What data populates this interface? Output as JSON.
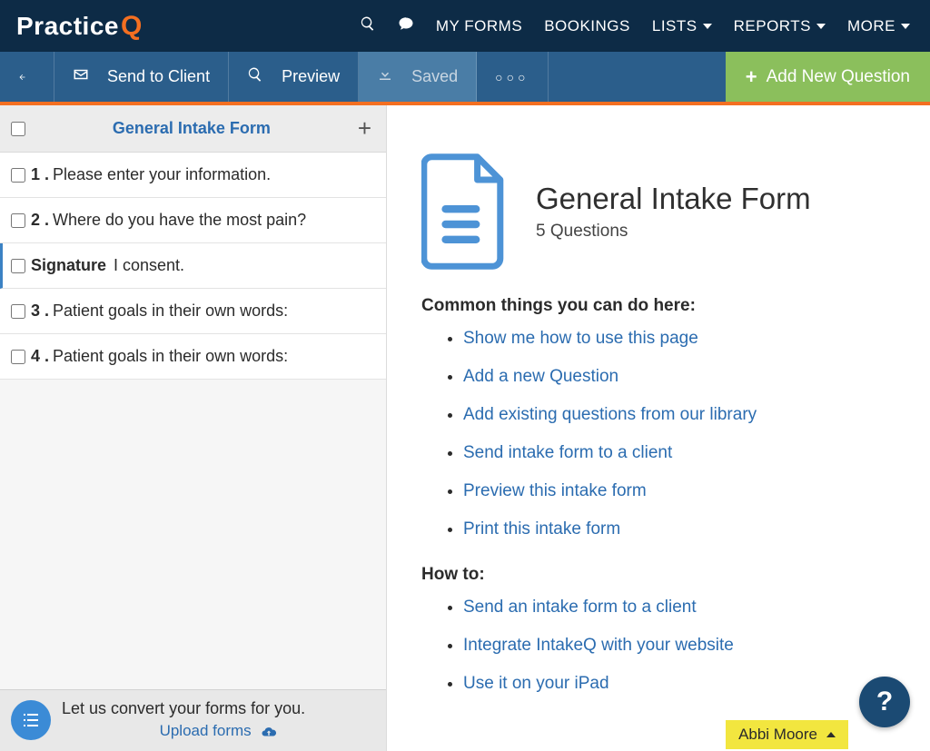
{
  "brand": {
    "name": "Practice",
    "accent_letter": "Q"
  },
  "topnav": {
    "items": [
      "MY FORMS",
      "BOOKINGS",
      "LISTS",
      "REPORTS",
      "MORE"
    ],
    "dropdown_flags": [
      false,
      false,
      true,
      true,
      true
    ]
  },
  "toolbar": {
    "send_label": "Send to Client",
    "preview_label": "Preview",
    "saved_label": "Saved",
    "add_new_label": "Add New Question"
  },
  "sidebar": {
    "form_title": "General Intake Form",
    "questions": [
      {
        "num": "1 .",
        "text": "Please enter your information."
      },
      {
        "num": "2 .",
        "text": "Where do you have the most pain?"
      },
      {
        "signature": true,
        "sig_label": "Signature",
        "text": "I consent."
      },
      {
        "num": "3 .",
        "text": "Patient goals in their own words:"
      },
      {
        "num": "4 .",
        "text": "Patient goals in their own words:"
      }
    ],
    "promo_line1": "Let us convert your forms for you.",
    "promo_cta": "Upload forms"
  },
  "main": {
    "title": "General Intake Form",
    "subtitle": "5 Questions",
    "common_heading": "Common things you can do here:",
    "common_links": [
      "Show me how to use this page",
      "Add a new Question",
      "Add existing questions from our library",
      "Send intake form to a client",
      "Preview this intake form",
      "Print this intake form"
    ],
    "howto_heading": "How to:",
    "howto_links": [
      "Send an intake form to a client",
      "Integrate IntakeQ with your website",
      "Use it on your iPad"
    ]
  },
  "user": {
    "name": "Abbi Moore"
  },
  "colors": {
    "brand_orange": "#f36f21",
    "nav_blue": "#0d2b46",
    "toolbar_blue": "#2b5e8b",
    "link_blue": "#2b6cb0",
    "add_green": "#8bbf5c",
    "chip_yellow": "#f2e63f"
  }
}
